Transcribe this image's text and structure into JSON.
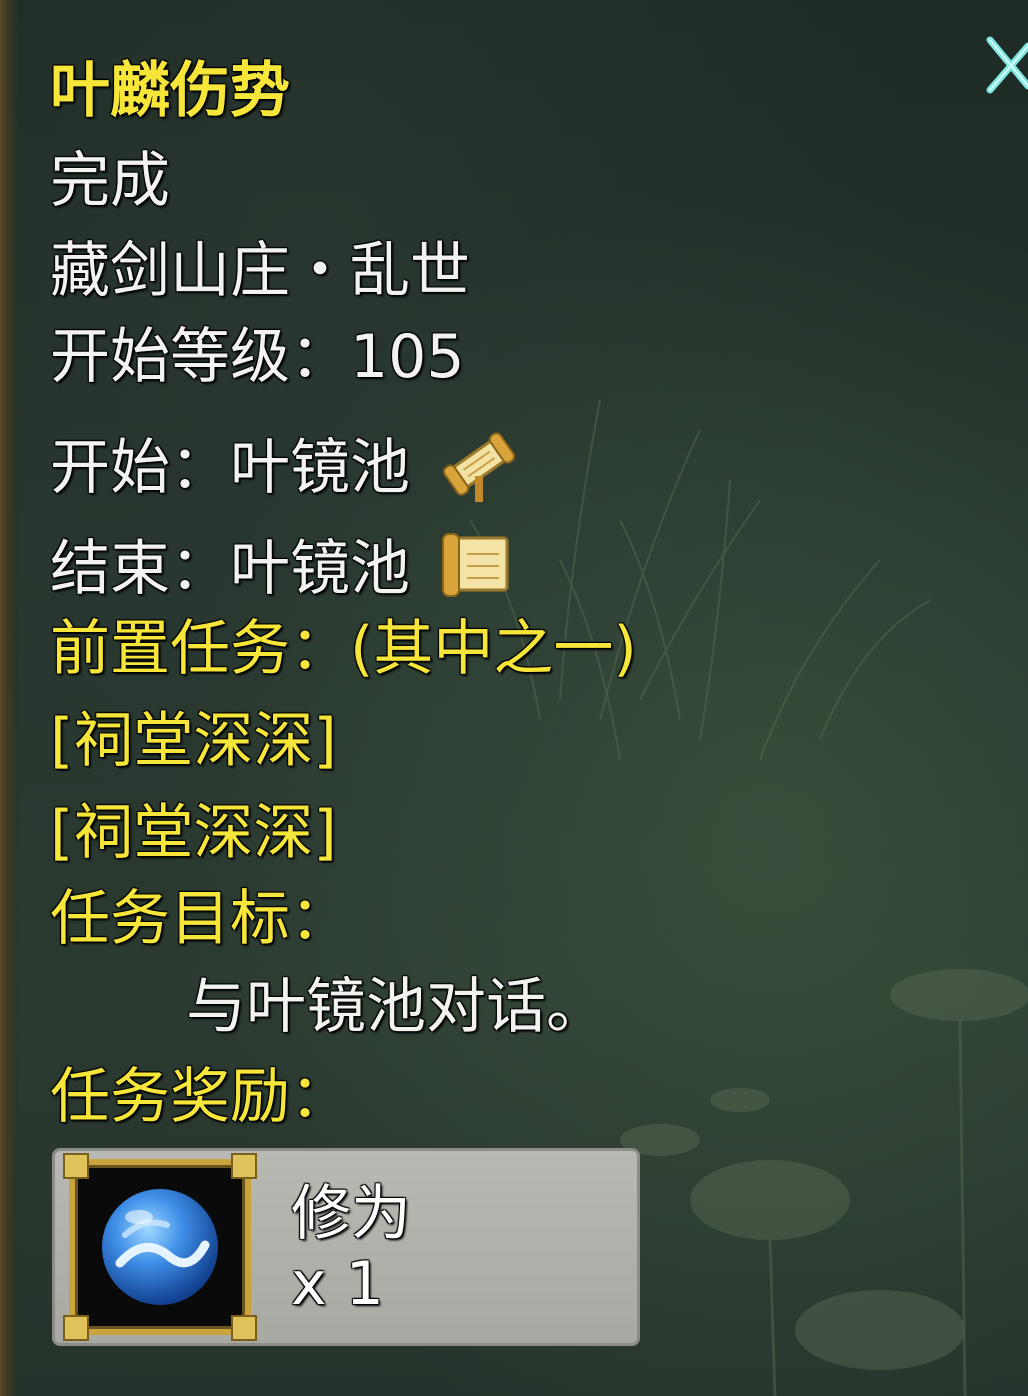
{
  "quest": {
    "title": "叶麟伤势",
    "status": "完成",
    "area": "藏剑山庄・乱世",
    "start_level_label": "开始等级：",
    "start_level_value": "105",
    "start_npc_label": "开始：",
    "start_npc_value": "叶镜池",
    "start_icon": "scroll-open-icon",
    "end_npc_label": "结束：",
    "end_npc_value": "叶镜池",
    "end_icon": "scroll-closed-icon",
    "prerequisite_label": "前置任务：(其中之一)",
    "prerequisites": [
      "[祠堂深深]",
      "[祠堂深深]"
    ],
    "objective_label": "任务目标：",
    "objective_text": "与叶镜池对话。",
    "reward_label": "任务奖励："
  },
  "reward": {
    "name": "修为",
    "count": "x 1",
    "icon": "blue-orb-icon"
  },
  "colors": {
    "title_yellow": "#f6e63a",
    "text_white": "#f2f2ee",
    "reward_box": "#b0b0aa",
    "frame_gold": "#c9a43c",
    "close_cyan": "#7ee8e0"
  }
}
